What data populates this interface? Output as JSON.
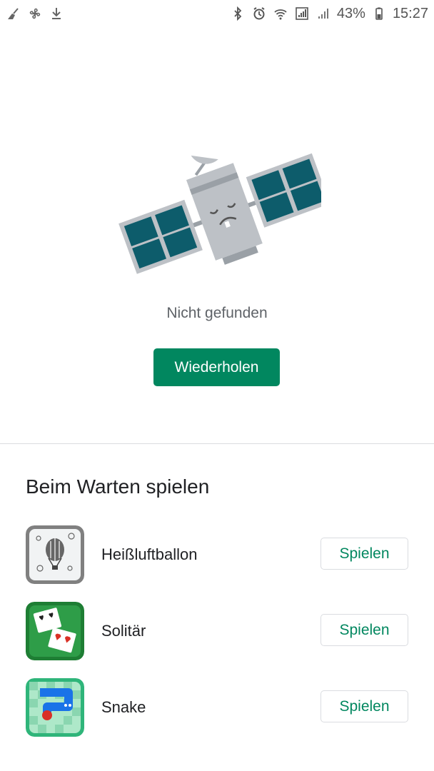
{
  "status_bar": {
    "left_icons": [
      "broom-icon",
      "fan-icon",
      "download-icon"
    ],
    "right_icons": [
      "bluetooth-icon",
      "alarm-icon",
      "wifi-icon",
      "sim-signal-icon",
      "cell-signal-icon",
      "battery-icon"
    ],
    "battery_percent": "43%",
    "time": "15:27"
  },
  "empty_state": {
    "illustration": "sad-satellite",
    "message": "Nicht gefunden",
    "retry_label": "Wiederholen"
  },
  "games_section": {
    "title": "Beim Warten spielen",
    "games": [
      {
        "name": "Heißluftballon",
        "icon": "balloon-game-icon",
        "play_label": "Spielen"
      },
      {
        "name": "Solitär",
        "icon": "solitaire-game-icon",
        "play_label": "Spielen"
      },
      {
        "name": "Snake",
        "icon": "snake-game-icon",
        "play_label": "Spielen"
      }
    ]
  },
  "colors": {
    "accent": "#01875f",
    "text_primary": "#202124",
    "text_secondary": "#5f6368"
  }
}
